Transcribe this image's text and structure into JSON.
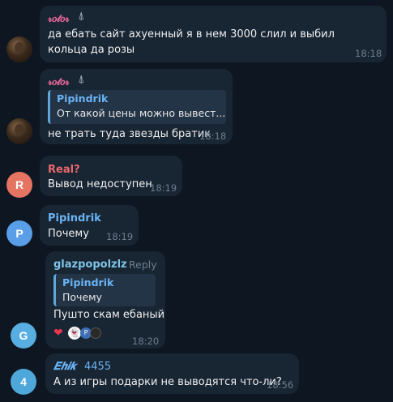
{
  "messages": [
    {
      "sender": "𝓇𝑜𝓉𝑜𝓇",
      "sender_icon": "rocket-icon",
      "sender_color": "#e9679a",
      "text": "да ебать сайт ахуенный я в нем 3000 слил и выбил кольца да розы",
      "time": "18:18"
    },
    {
      "sender": "𝓇𝑜𝓉𝑜𝓇",
      "sender_icon": "rocket-icon",
      "sender_color": "#e9679a",
      "reply": {
        "name": "Pipindrik",
        "text": "От какой цены можно вывест..."
      },
      "text": "не трать туда звезды братик",
      "time": "18:18"
    },
    {
      "sender": "Real?",
      "sender_color": "#e9676d",
      "avatar_letter": "R",
      "avatar_color": "#e57463",
      "text": "Вывод недоступен",
      "time": "18:19"
    },
    {
      "sender": "Pipindrik",
      "sender_color": "#6ab3f3",
      "avatar_letter": "P",
      "avatar_color": "#5a9ee8",
      "text": "Почему",
      "time": "18:19"
    },
    {
      "sender": "glazpopolzlz",
      "sender_color": "#7ec4e6",
      "reply_link": "Reply",
      "avatar_letter": "G",
      "avatar_color": "#58aee0",
      "reply": {
        "name": "Pipindrik",
        "text": "Почему"
      },
      "text": "Пушто скам ебаный",
      "time": "18:20",
      "reactions": [
        "heart",
        "ghost",
        "P",
        "avatar"
      ]
    },
    {
      "sender": "𝑬𝒉𝒊𝒌",
      "sender_suffix": "4455",
      "sender_color": "#6ab3f3",
      "avatar_letter": "4",
      "avatar_color": "#4fa6d8",
      "text": "А из игры подарки не выводятся что-ли?",
      "time": "18:56"
    }
  ]
}
